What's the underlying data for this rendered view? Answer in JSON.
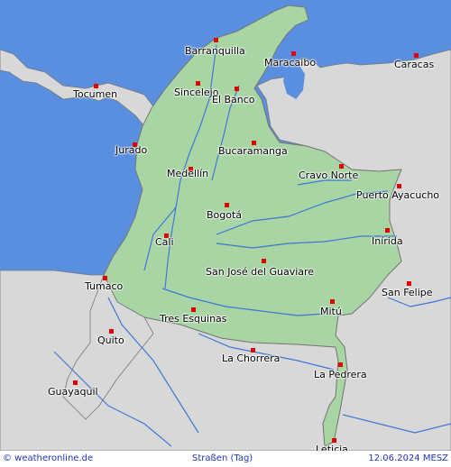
{
  "footer": {
    "source": "© weatheronline.de",
    "layer": "Straßen (Tag)",
    "date": "12.06.2024 MESZ"
  },
  "colors": {
    "sea": "#5a8fe0",
    "land_outside": "#d8d8d8",
    "colombia": "#a8d5a3",
    "border": "#777777",
    "river": "#3f78d8",
    "marker": "#e00000",
    "footer_text": "#2233bb"
  },
  "cities": [
    {
      "name": "Barranquilla"
    },
    {
      "name": "Maracaibo"
    },
    {
      "name": "Caracas"
    },
    {
      "name": "Tocumen"
    },
    {
      "name": "Sincelejo"
    },
    {
      "name": "El Banco"
    },
    {
      "name": "Jurado"
    },
    {
      "name": "Bucaramanga"
    },
    {
      "name": "Medellín"
    },
    {
      "name": "Cravo Norte"
    },
    {
      "name": "Puerto Ayacucho"
    },
    {
      "name": "Bogotá"
    },
    {
      "name": "Cali"
    },
    {
      "name": "Inírida"
    },
    {
      "name": "San José del Guaviare"
    },
    {
      "name": "Tumaco"
    },
    {
      "name": "San Felipe"
    },
    {
      "name": "Mitú"
    },
    {
      "name": "Tres Esquinas"
    },
    {
      "name": "Quito"
    },
    {
      "name": "La Chorrera"
    },
    {
      "name": "La Pedrera"
    },
    {
      "name": "Guayaquil"
    },
    {
      "name": "Leticia"
    }
  ]
}
